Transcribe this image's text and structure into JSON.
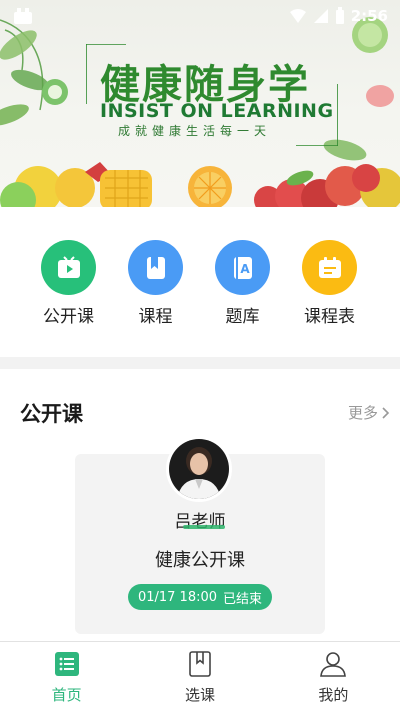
{
  "status_bar": {
    "time": "2:56"
  },
  "banner": {
    "title": "健康随身学",
    "subtitle": "INSIST ON LEARNING",
    "slogan": "成就健康生活每一天"
  },
  "quick_nav": [
    {
      "label": "公开课",
      "icon": "play-tv-icon",
      "color": "#27c07a"
    },
    {
      "label": "课程",
      "icon": "book-icon",
      "color": "#4a9bf5"
    },
    {
      "label": "题库",
      "icon": "question-bank-icon",
      "color": "#4a9bf5"
    },
    {
      "label": "课程表",
      "icon": "schedule-icon",
      "color": "#fbbb12"
    }
  ],
  "section": {
    "title": "公开课",
    "more": "更多"
  },
  "course_card": {
    "teacher": "吕老师",
    "title": "健康公开课",
    "date": "01/17 18:00",
    "status": "已结束"
  },
  "tab_bar": {
    "tabs": [
      {
        "label": "首页",
        "icon": "home-list-icon",
        "active": true
      },
      {
        "label": "选课",
        "icon": "course-book-icon",
        "active": false
      },
      {
        "label": "我的",
        "icon": "user-icon",
        "active": false
      }
    ],
    "active_color": "#2eb67d"
  }
}
